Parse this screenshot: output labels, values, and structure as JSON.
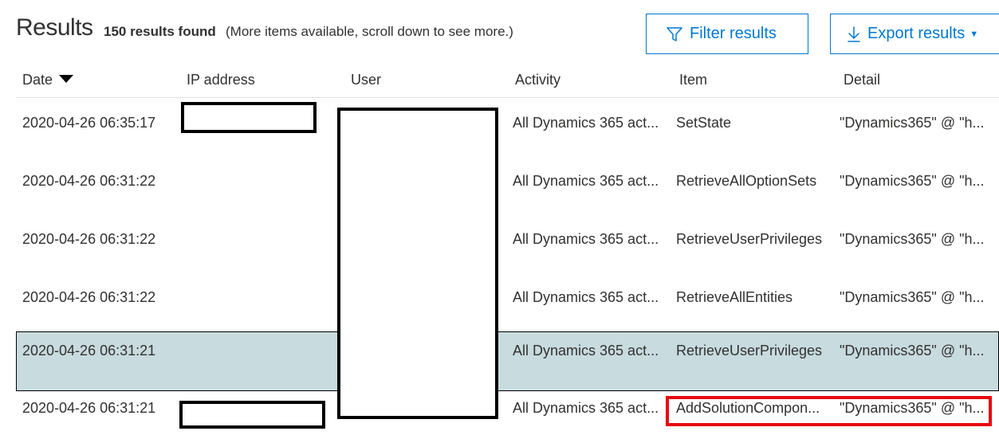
{
  "header": {
    "title": "Results",
    "count": "150 results found",
    "note": "(More items available, scroll down to see more.)",
    "filter_label": "Filter results",
    "export_label": "Export results",
    "filter_icon": "filter-icon",
    "export_icon": "download-icon",
    "accent_color": "#0078d4"
  },
  "table": {
    "columns": [
      "Date",
      "IP address",
      "User",
      "Activity",
      "Item",
      "Detail"
    ],
    "sort_column": "Date",
    "sort_direction": "descending",
    "selected_row_color": "#c8dbdf",
    "rows": [
      {
        "date": "2020-04-26 06:35:17",
        "ip": "",
        "user": "",
        "activity": "All Dynamics 365 act...",
        "item": "SetState",
        "detail": "\"Dynamics365\" @ \"h..."
      },
      {
        "date": "2020-04-26 06:31:22",
        "ip": "",
        "user": "",
        "activity": "All Dynamics 365 act...",
        "item": "RetrieveAllOptionSets",
        "detail": "\"Dynamics365\" @ \"h..."
      },
      {
        "date": "2020-04-26 06:31:22",
        "ip": "",
        "user": "",
        "activity": "All Dynamics 365 act...",
        "item": "RetrieveUserPrivileges",
        "detail": "\"Dynamics365\" @ \"h..."
      },
      {
        "date": "2020-04-26 06:31:22",
        "ip": "",
        "user": "",
        "activity": "All Dynamics 365 act...",
        "item": "RetrieveAllEntities",
        "detail": "\"Dynamics365\" @ \"h..."
      },
      {
        "date": "2020-04-26 06:31:21",
        "ip": "",
        "user": "",
        "activity": "All Dynamics 365 act...",
        "item": "RetrieveUserPrivileges",
        "detail": "\"Dynamics365\" @ \"h..."
      },
      {
        "date": "2020-04-26 06:31:21",
        "ip": "",
        "user": "",
        "activity": "All Dynamics 365 act...",
        "item": "AddSolutionCompon...",
        "detail": "\"Dynamics365\" @ \"h..."
      }
    ]
  },
  "annotation": {
    "highlight_color": "#e8090f",
    "redaction_color": "#000000"
  }
}
